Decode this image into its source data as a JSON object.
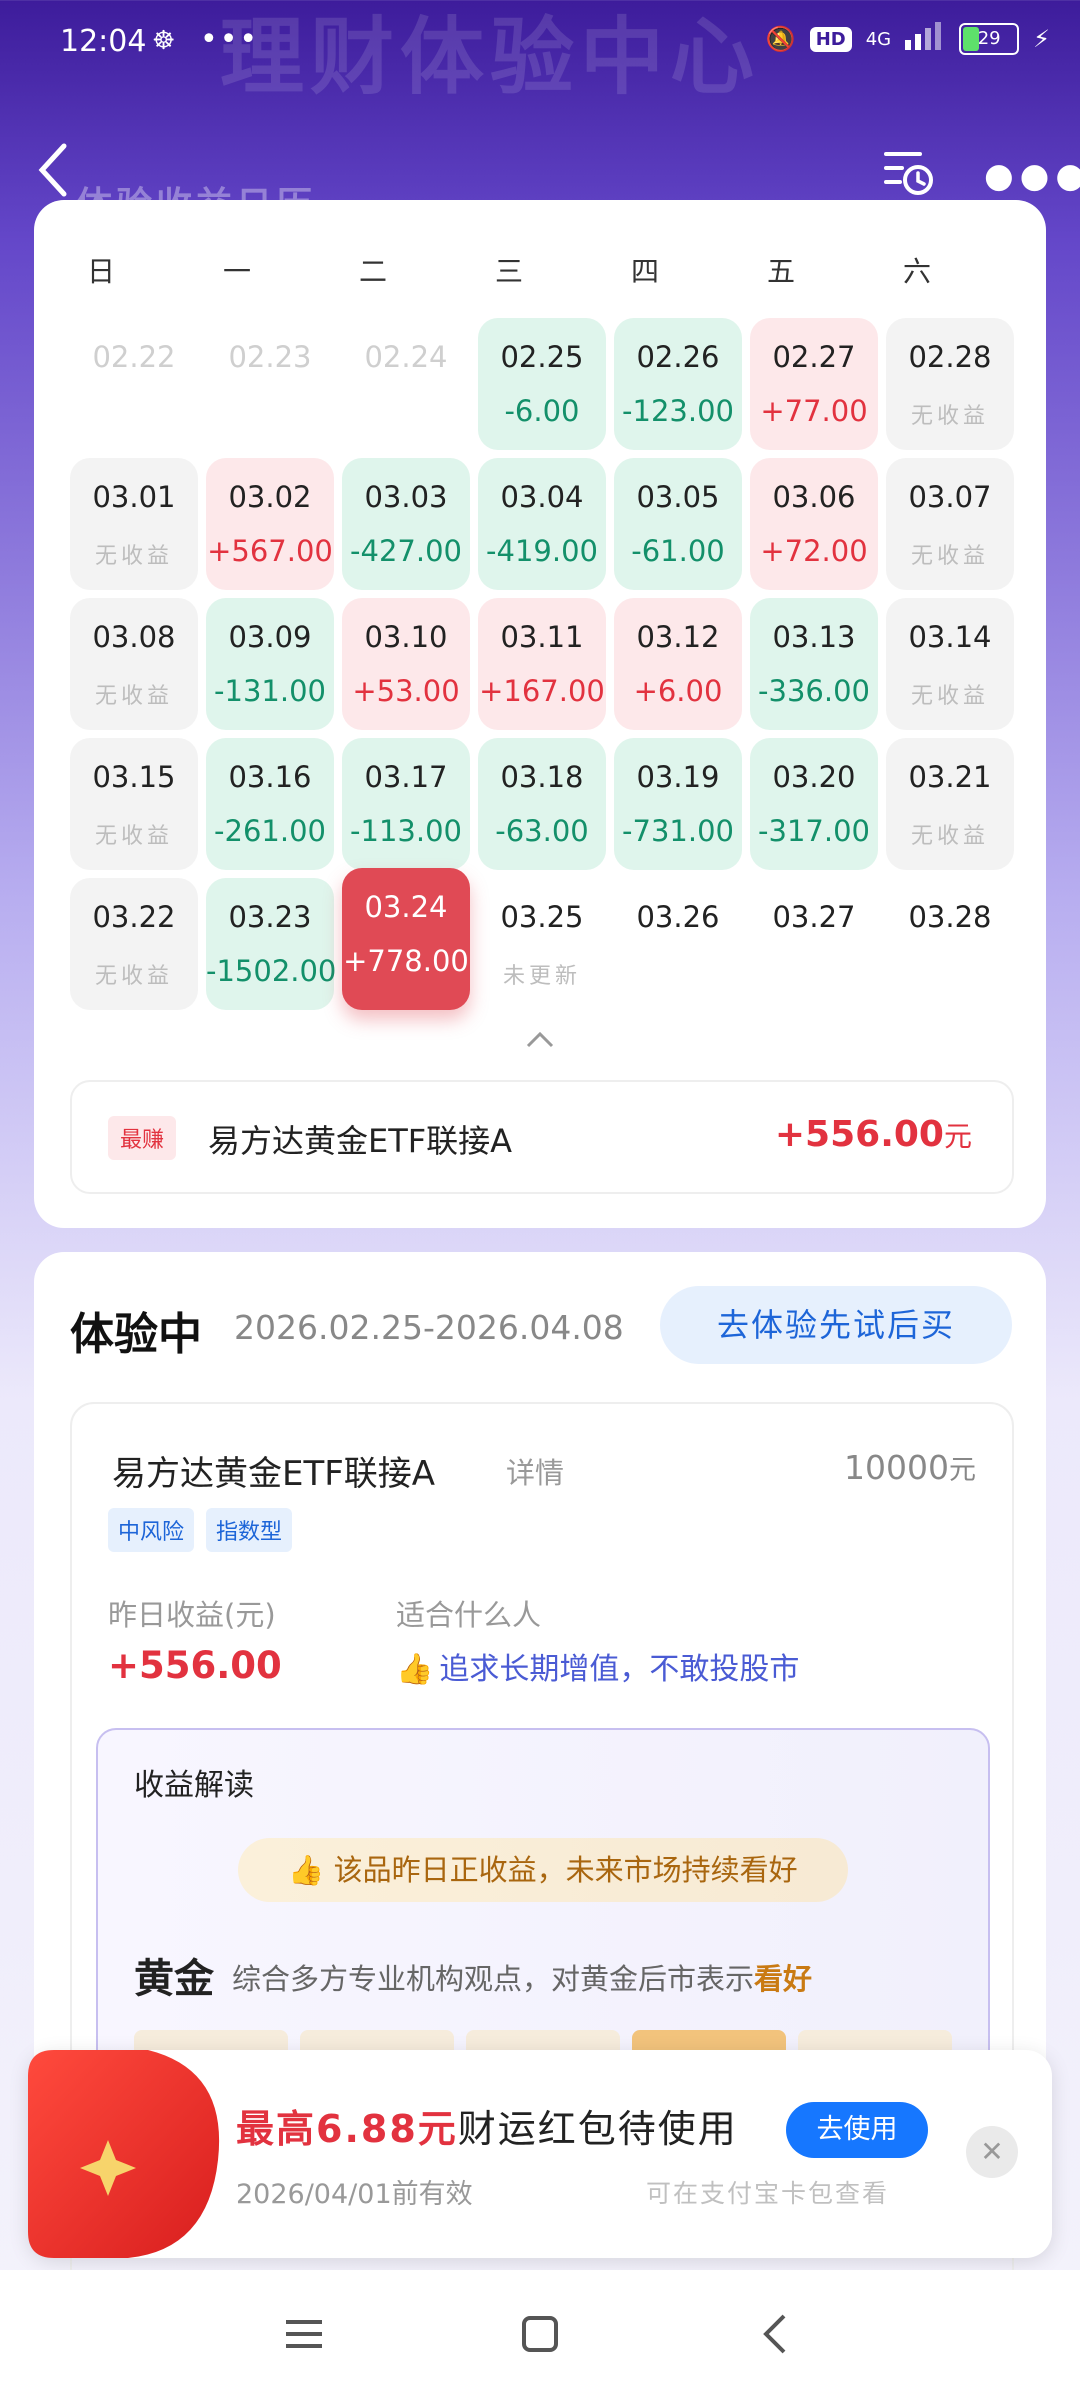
{
  "status_bar": {
    "time": "12:04",
    "dots": "•••",
    "hd": "HD",
    "network": "4G",
    "battery": "29"
  },
  "page": {
    "bg_title": "理财体验中心",
    "ghost_subtitle": "体验收益日历"
  },
  "calendar": {
    "weekdays": [
      "日",
      "一",
      "二",
      "三",
      "四",
      "五",
      "六"
    ],
    "days": [
      {
        "date": "02.22",
        "value": "",
        "state": "past"
      },
      {
        "date": "02.23",
        "value": "",
        "state": "past"
      },
      {
        "date": "02.24",
        "value": "",
        "state": "past"
      },
      {
        "date": "02.25",
        "value": "-6.00",
        "state": "neg"
      },
      {
        "date": "02.26",
        "value": "-123.00",
        "state": "neg"
      },
      {
        "date": "02.27",
        "value": "+77.00",
        "state": "pos"
      },
      {
        "date": "02.28",
        "value": "无收益",
        "state": "none"
      },
      {
        "date": "03.01",
        "value": "无收益",
        "state": "none"
      },
      {
        "date": "03.02",
        "value": "+567.00",
        "state": "pos"
      },
      {
        "date": "03.03",
        "value": "-427.00",
        "state": "neg"
      },
      {
        "date": "03.04",
        "value": "-419.00",
        "state": "neg"
      },
      {
        "date": "03.05",
        "value": "-61.00",
        "state": "neg"
      },
      {
        "date": "03.06",
        "value": "+72.00",
        "state": "pos"
      },
      {
        "date": "03.07",
        "value": "无收益",
        "state": "none"
      },
      {
        "date": "03.08",
        "value": "无收益",
        "state": "none"
      },
      {
        "date": "03.09",
        "value": "-131.00",
        "state": "neg"
      },
      {
        "date": "03.10",
        "value": "+53.00",
        "state": "pos"
      },
      {
        "date": "03.11",
        "value": "+167.00",
        "state": "pos"
      },
      {
        "date": "03.12",
        "value": "+6.00",
        "state": "pos"
      },
      {
        "date": "03.13",
        "value": "-336.00",
        "state": "neg"
      },
      {
        "date": "03.14",
        "value": "无收益",
        "state": "none"
      },
      {
        "date": "03.15",
        "value": "无收益",
        "state": "none"
      },
      {
        "date": "03.16",
        "value": "-261.00",
        "state": "neg"
      },
      {
        "date": "03.17",
        "value": "-113.00",
        "state": "neg"
      },
      {
        "date": "03.18",
        "value": "-63.00",
        "state": "neg"
      },
      {
        "date": "03.19",
        "value": "-731.00",
        "state": "neg"
      },
      {
        "date": "03.20",
        "value": "-317.00",
        "state": "neg"
      },
      {
        "date": "03.21",
        "value": "无收益",
        "state": "none"
      },
      {
        "date": "03.22",
        "value": "无收益",
        "state": "none"
      },
      {
        "date": "03.23",
        "value": "-1502.00",
        "state": "neg"
      },
      {
        "date": "03.24",
        "value": "+778.00",
        "state": "sel"
      },
      {
        "date": "03.25",
        "value": "未更新",
        "state": "pending"
      },
      {
        "date": "03.26",
        "value": "",
        "state": "blank"
      },
      {
        "date": "03.27",
        "value": "",
        "state": "blank"
      },
      {
        "date": "03.28",
        "value": "",
        "state": "blank"
      }
    ],
    "top_earner": {
      "tag": "最赚",
      "name": "易方达黄金ETF联接A",
      "value": "+556.00",
      "unit": "元"
    }
  },
  "experience": {
    "title": "体验中",
    "range": "2026.02.25-2026.04.08",
    "button": "去体验先试后买",
    "fund": {
      "name": "易方达黄金ETF联接A",
      "detail": "详情",
      "amount": "10000",
      "unit": "元",
      "tags": [
        "中风险",
        "指数型"
      ],
      "yesterday_label": "昨日收益(元)",
      "yesterday_value": "+556.00",
      "suitable_label": "适合什么人",
      "suitable_value": "追求长期增值，不敢投股市",
      "interpretation": {
        "title": "收益解读",
        "pill": "该品昨日正收益，未来市场持续看好",
        "asset": "黄金",
        "desc": "综合多方专业机构观点，对黄金后市表示",
        "desc_hl": "看好"
      }
    }
  },
  "red_packet": {
    "prefix": "最高",
    "amount": "6.88元",
    "suffix": "财运红包待使用",
    "button": "去使用",
    "valid": "2026/04/01前有效",
    "where": "可在支付宝卡包查看"
  },
  "colors": {
    "pos": "#e2323f",
    "neg": "#13906a",
    "brand": "#1677ff",
    "header": "#3d1c9b"
  }
}
